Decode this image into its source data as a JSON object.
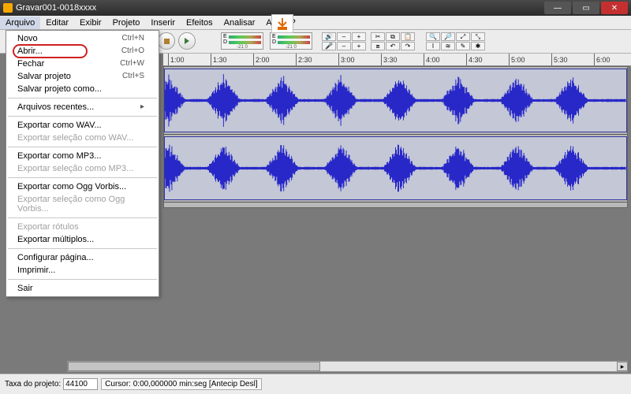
{
  "title": "Gravar001-0018xxxx",
  "menus": [
    "Arquivo",
    "Editar",
    "Exibir",
    "Projeto",
    "Inserir",
    "Efeitos",
    "Analisar",
    "Ajuda ?"
  ],
  "meter_ticks": "-21  0",
  "timeline": [
    "1:00",
    "1:30",
    "2:00",
    "2:30",
    "3:00",
    "3:30",
    "4:00",
    "4:30",
    "5:00",
    "5:30",
    "6:00"
  ],
  "file_menu": [
    {
      "label": "Novo",
      "shortcut": "Ctrl+N"
    },
    {
      "label": "Abrir...",
      "shortcut": "Ctrl+O",
      "highlight": true
    },
    {
      "label": "Fechar",
      "shortcut": "Ctrl+W"
    },
    {
      "label": "Salvar projeto",
      "shortcut": "Ctrl+S"
    },
    {
      "label": "Salvar projeto como..."
    },
    {
      "sep": true
    },
    {
      "label": "Arquivos recentes...",
      "submenu": true
    },
    {
      "sep": true
    },
    {
      "label": "Exportar como WAV..."
    },
    {
      "label": "Exportar seleção como WAV...",
      "disabled": true
    },
    {
      "sep": true
    },
    {
      "label": "Exportar como MP3..."
    },
    {
      "label": "Exportar seleção como MP3...",
      "disabled": true
    },
    {
      "sep": true
    },
    {
      "label": "Exportar como Ogg Vorbis..."
    },
    {
      "label": "Exportar seleção como Ogg Vorbis...",
      "disabled": true
    },
    {
      "sep": true
    },
    {
      "label": "Exportar rótulos",
      "disabled": true
    },
    {
      "label": "Exportar múltiplos..."
    },
    {
      "sep": true
    },
    {
      "label": "Configurar página..."
    },
    {
      "label": "Imprimir..."
    },
    {
      "sep": true
    },
    {
      "label": "Sair"
    }
  ],
  "status": {
    "rate_label": "Taxa do projeto:",
    "rate_value": "44100",
    "cursor": "Cursor:  0:00,000000 min:seg  [Antecip Desl]"
  }
}
